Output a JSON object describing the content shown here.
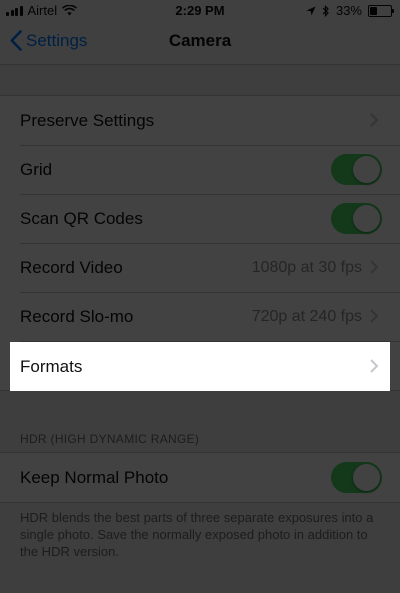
{
  "status_bar": {
    "carrier": "Airtel",
    "time": "2:29 PM",
    "battery": "33%",
    "battery_level": 0.33
  },
  "nav": {
    "back_label": "Settings",
    "title": "Camera"
  },
  "group1": {
    "preserve_settings": "Preserve Settings",
    "grid": {
      "label": "Grid",
      "on": true
    },
    "scan_qr": {
      "label": "Scan QR Codes",
      "on": true
    },
    "record_video": {
      "label": "Record Video",
      "value": "1080p at 30 fps"
    },
    "record_slomo": {
      "label": "Record Slo-mo",
      "value": "720p at 240 fps"
    },
    "formats": "Formats"
  },
  "hdr": {
    "header": "HDR (HIGH DYNAMIC RANGE)",
    "keep_normal": {
      "label": "Keep Normal Photo",
      "on": true
    },
    "footer": "HDR blends the best parts of three separate exposures into a single photo. Save the normally exposed photo in addition to the HDR version."
  },
  "colors": {
    "accent": "#007aff",
    "toggle_on": "#4cd964",
    "overlay": "rgba(0,0,0,0.74)"
  },
  "icons": [
    "wifi-icon",
    "signal-bars-icon",
    "location-arrow-icon",
    "bluetooth-icon",
    "battery-icon",
    "chevron-left-icon",
    "chevron-right-icon"
  ]
}
